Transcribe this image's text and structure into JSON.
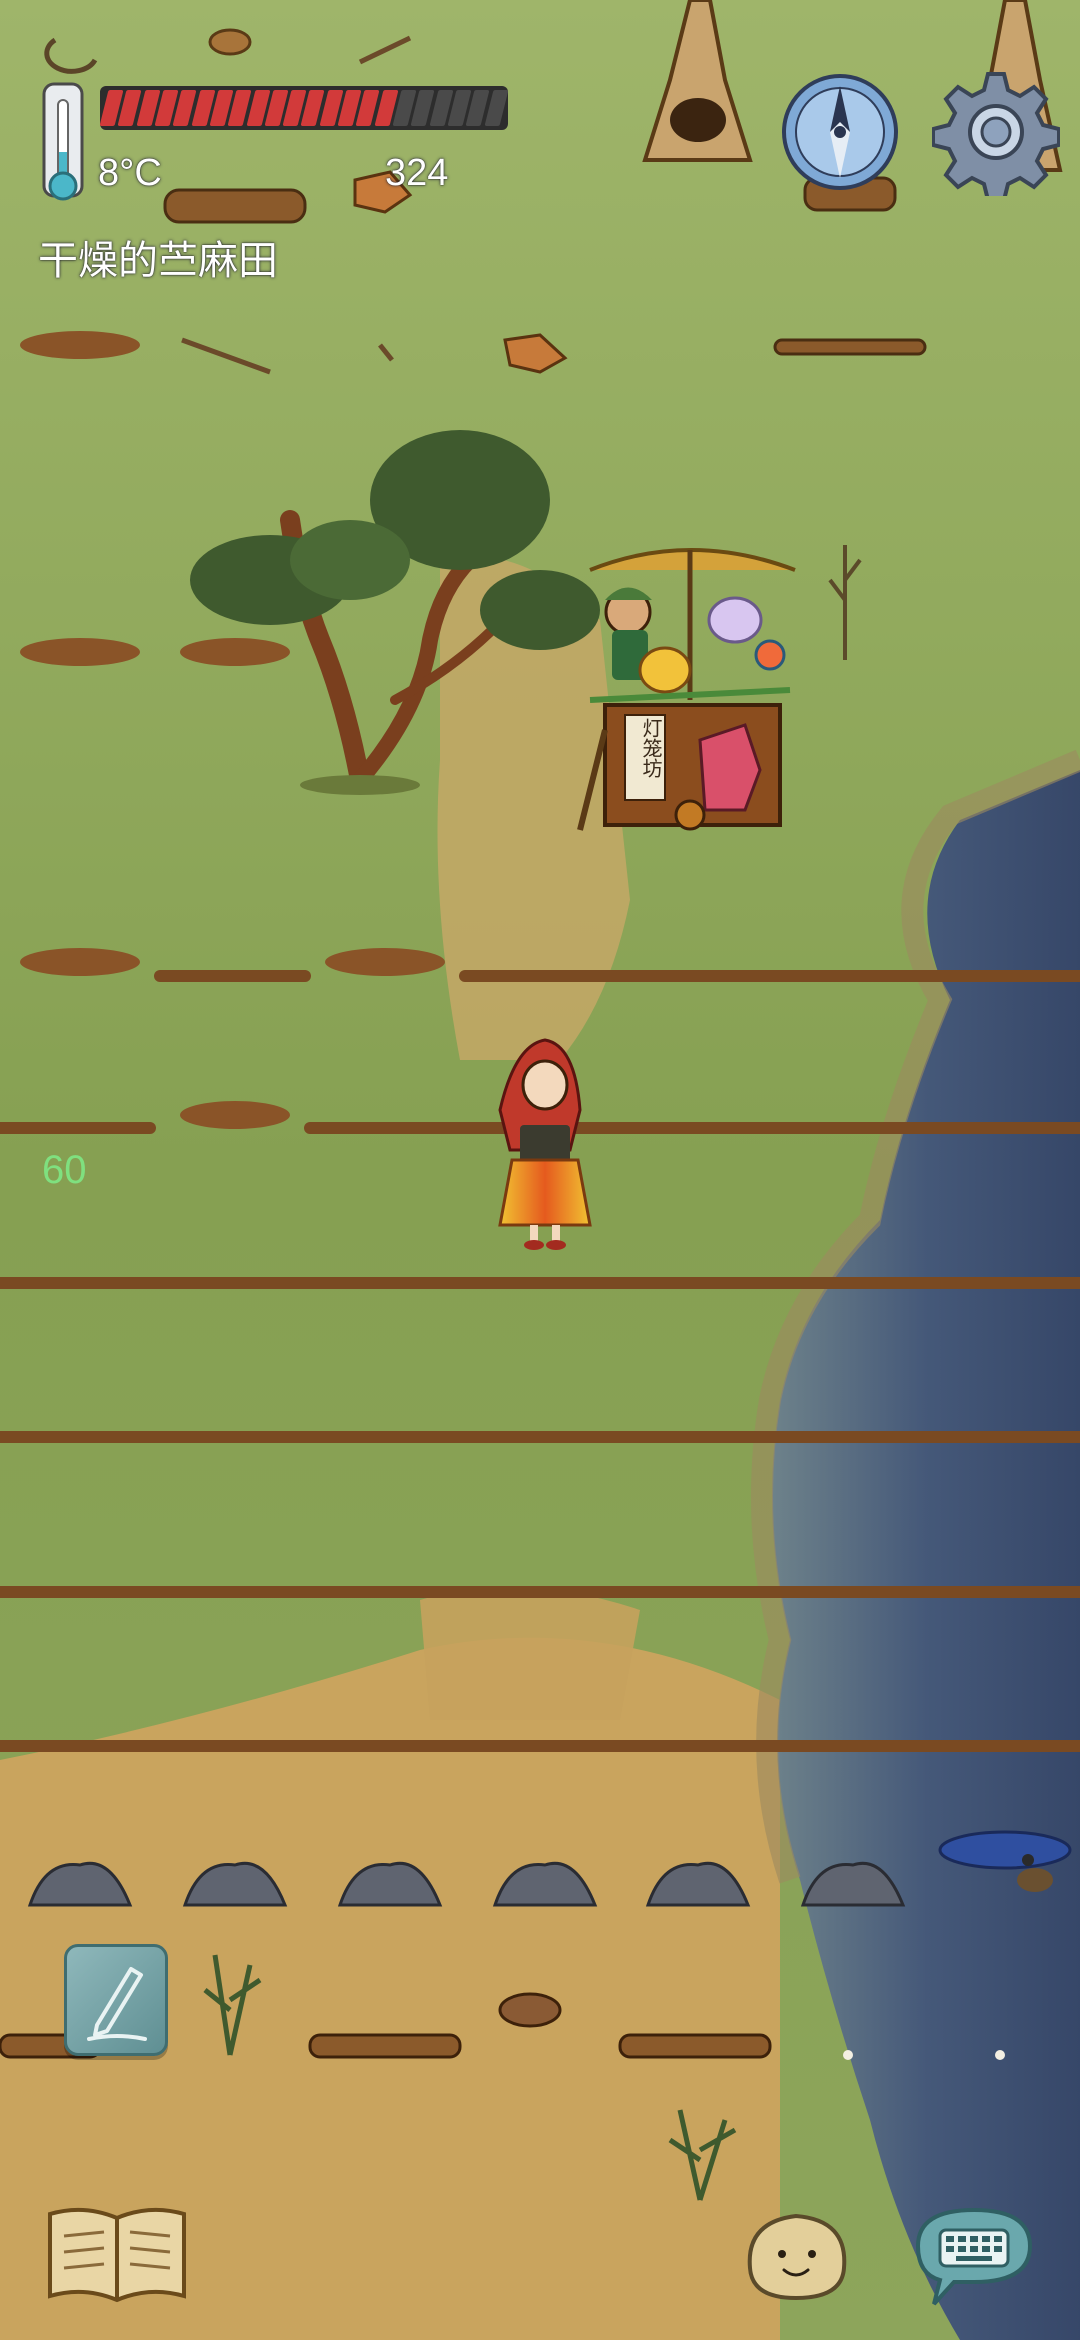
{
  "hud": {
    "temperature": "8°C",
    "health_fraction": 0.73,
    "health_segments_total": 22,
    "score": "324",
    "location": "干燥的苎麻田"
  },
  "debug": {
    "fps": "60"
  },
  "npc": {
    "stall_sign": "灯笼坊"
  },
  "colors": {
    "health_fill": "#d23a3a",
    "health_empty": "#4a4a4a",
    "grass": "#8ea45a",
    "dirt": "#c9a45e",
    "water": "#4a5e86",
    "fps_text": "#7fe07f"
  },
  "icons": {
    "thermometer": "thermometer-icon",
    "compass": "compass-icon",
    "settings": "gear-icon",
    "note": "pencil-note-icon",
    "journal": "open-book-icon",
    "emote": "potato-face-icon",
    "keyboard": "keyboard-chat-icon"
  }
}
